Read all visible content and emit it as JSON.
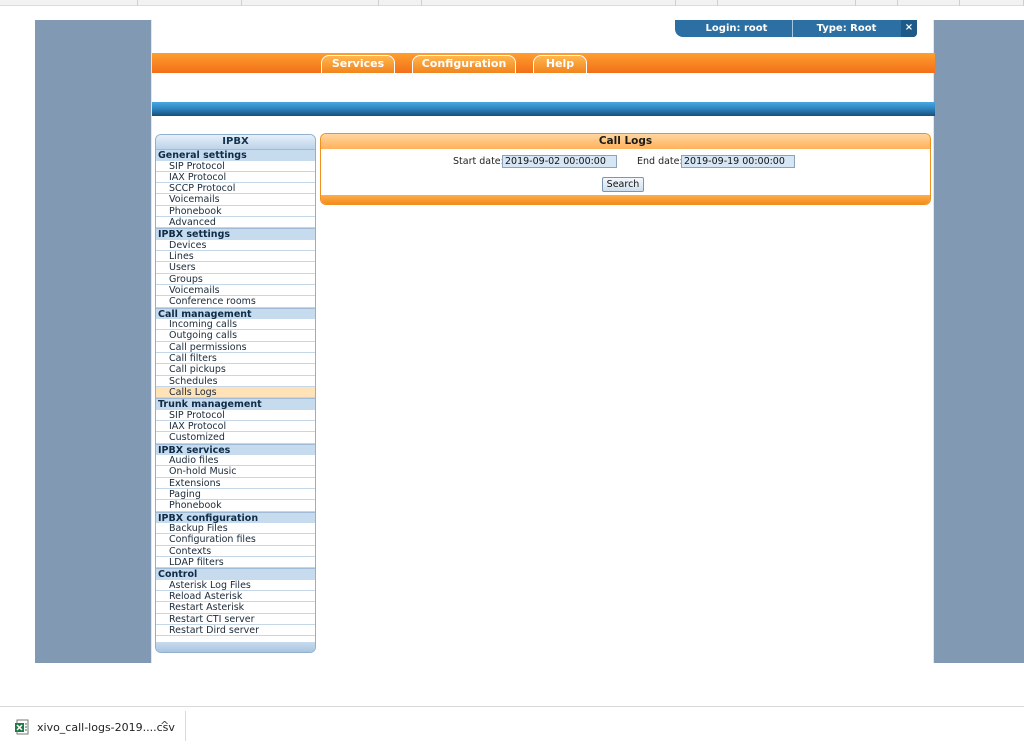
{
  "header": {
    "login_label": "Login: root",
    "type_label": "Type: Root",
    "close_glyph": "×"
  },
  "nav": {
    "tabs": [
      "Services",
      "Configuration",
      "Help"
    ]
  },
  "sidebar": {
    "title": "IPBX",
    "sections": [
      {
        "label": "General settings",
        "items": [
          "SIP Protocol",
          "IAX Protocol",
          "SCCP Protocol",
          "Voicemails",
          "Phonebook",
          "Advanced"
        ]
      },
      {
        "label": "IPBX settings",
        "items": [
          "Devices",
          "Lines",
          "Users",
          "Groups",
          "Voicemails",
          "Conference rooms"
        ]
      },
      {
        "label": "Call management",
        "items": [
          "Incoming calls",
          "Outgoing calls",
          "Call permissions",
          "Call filters",
          "Call pickups",
          "Schedules",
          "Calls Logs"
        ]
      },
      {
        "label": "Trunk management",
        "items": [
          "SIP Protocol",
          "IAX Protocol",
          "Customized"
        ]
      },
      {
        "label": "IPBX services",
        "items": [
          "Audio files",
          "On-hold Music",
          "Extensions",
          "Paging",
          "Phonebook"
        ]
      },
      {
        "label": "IPBX configuration",
        "items": [
          "Backup Files",
          "Configuration files",
          "Contexts",
          "LDAP filters"
        ]
      },
      {
        "label": "Control",
        "items": [
          "Asterisk Log Files",
          "Reload Asterisk",
          "Restart Asterisk",
          "Restart CTI server",
          "Restart Dird server"
        ]
      }
    ],
    "active_item": "Calls Logs"
  },
  "panel": {
    "title": "Call Logs",
    "start_label": "Start date:",
    "start_value": "2019-09-02 00:00:00",
    "end_label": "End date:",
    "end_value": "2019-09-19 00:00:00",
    "search_label": "Search"
  },
  "download": {
    "file_name": "xivo_call-logs-2019....csv",
    "chevron": "^"
  },
  "colors": {
    "side_bg": "#8299b4",
    "orange": "#f26f18",
    "blue": "#2f86c4",
    "active_item": "#ffe2b8"
  }
}
